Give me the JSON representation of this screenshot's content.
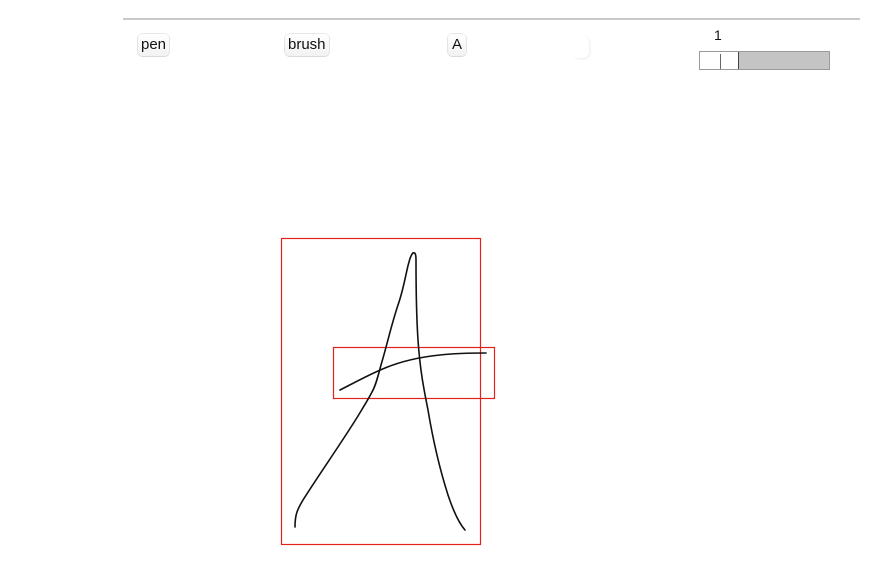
{
  "toolbar": {
    "pen_label": "pen",
    "brush_label": "brush",
    "text_label": "A",
    "color_icon": "color-swatch",
    "size_label": "1",
    "size_slider_value": 0.3
  },
  "canvas": {
    "stroke_color": "#111111",
    "box_color": "#e0241c",
    "background": "#ffffff"
  }
}
